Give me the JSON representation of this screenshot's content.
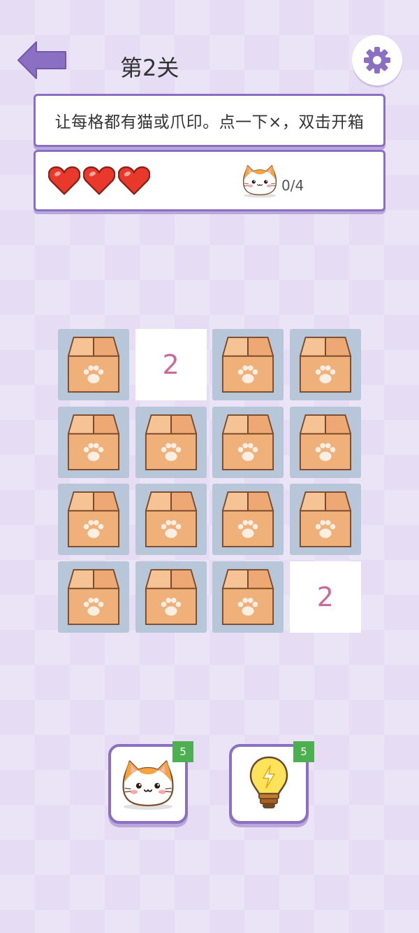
{
  "header": {
    "level_title": "第2关"
  },
  "instruction": {
    "text": "让每格都有猫或爪印。点一下×，双击开箱"
  },
  "status": {
    "lives": 3,
    "cats_found": "0/4"
  },
  "grid": {
    "rows": 4,
    "cols": 4,
    "cells": [
      [
        "box",
        "2",
        "box",
        "box"
      ],
      [
        "box",
        "box",
        "box",
        "box"
      ],
      [
        "box",
        "box",
        "box",
        "box"
      ],
      [
        "box",
        "box",
        "box",
        "2"
      ]
    ]
  },
  "tools": [
    {
      "name": "cat-hint",
      "icon": "cat-icon",
      "count": "5"
    },
    {
      "name": "bulb-hint",
      "icon": "lightbulb-icon",
      "count": "5"
    }
  ],
  "colors": {
    "accent": "#8a6fc2",
    "number": "#c96a9a",
    "badge": "#4caf50",
    "box_bg": "#b8c6d9"
  }
}
